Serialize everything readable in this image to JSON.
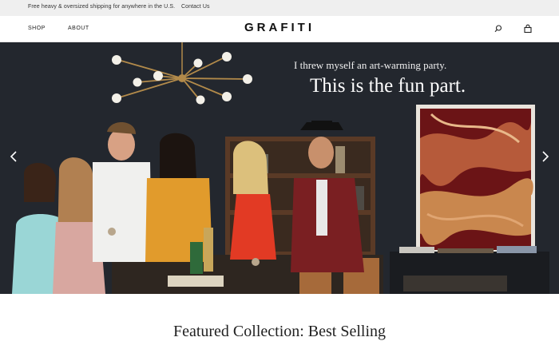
{
  "announcement": {
    "shipping_text": "Free heavy & oversized shipping for anywhere in the U.S.",
    "contact_link": "Contact Us"
  },
  "header": {
    "nav": [
      "SHOP",
      "ABOUT"
    ],
    "logo": "GRAFITI",
    "icons": [
      "search-icon",
      "bag-icon"
    ]
  },
  "hero": {
    "kicker": "I threw myself an art-warming party.",
    "title": "This is the fun part.",
    "controls": [
      "chevron-left-icon",
      "chevron-right-icon"
    ]
  },
  "section": {
    "title": "Featured Collection: Best Selling"
  },
  "colors": {
    "background": "#ffffff",
    "announcement_bar": "#efefef",
    "hero_wall": "#23272e",
    "text_dark": "#222222"
  }
}
